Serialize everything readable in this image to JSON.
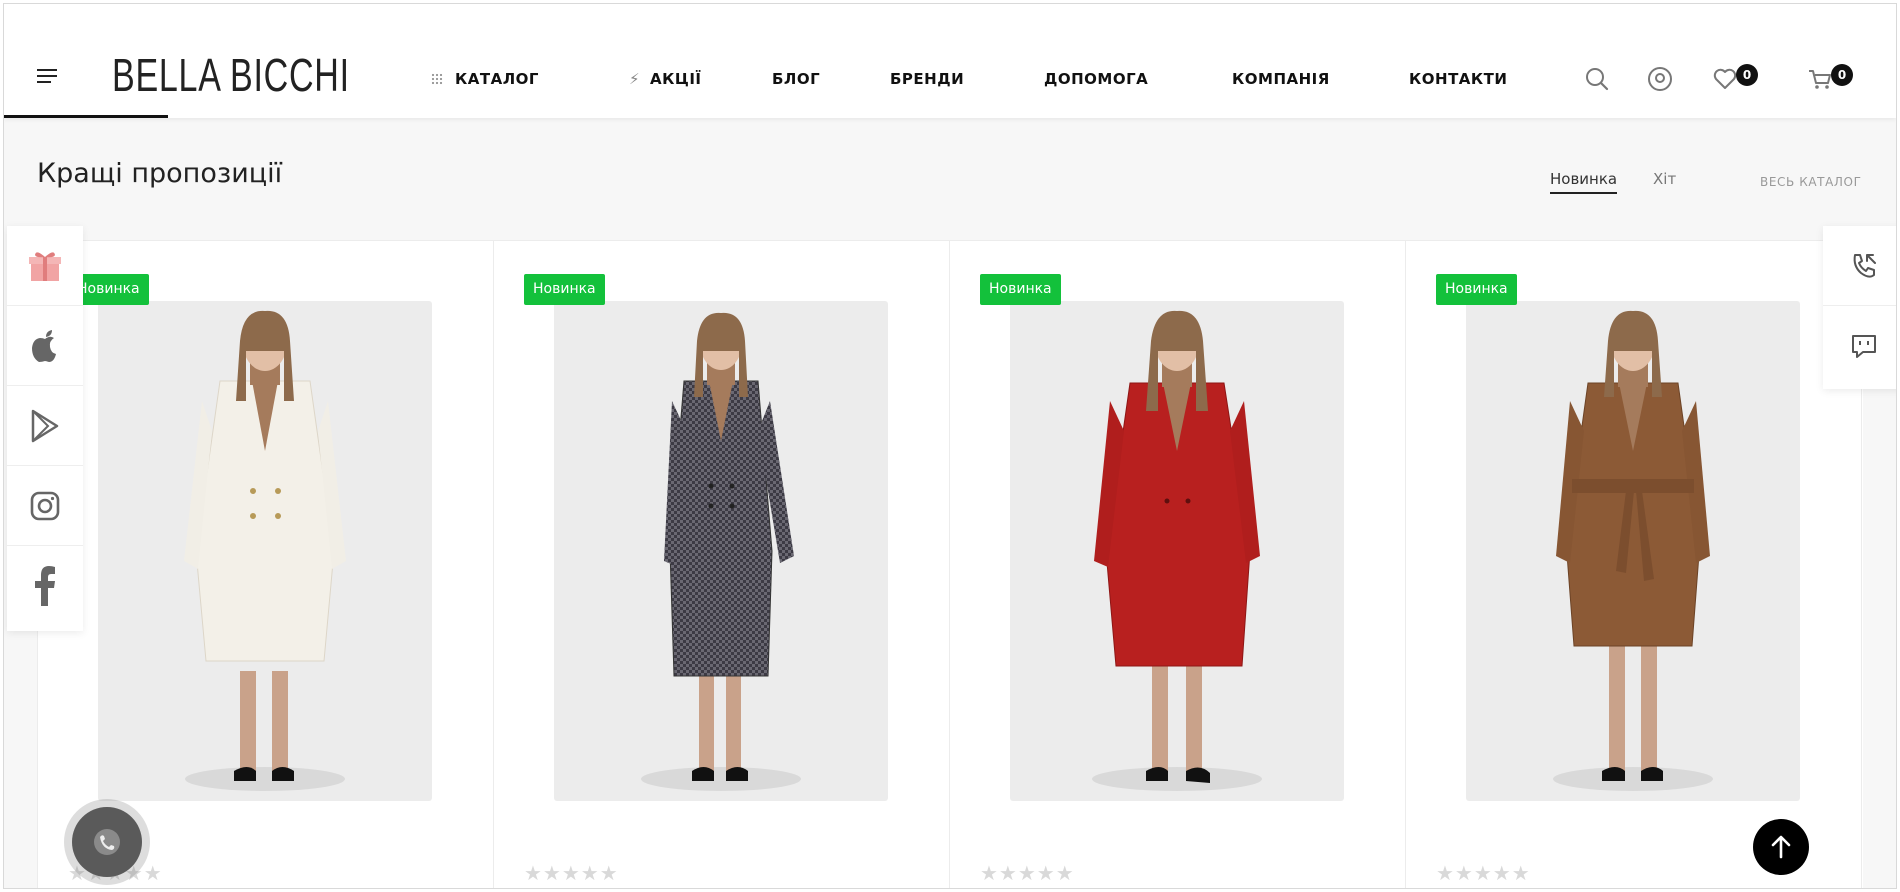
{
  "header": {
    "logo": "BELLA BICCHI",
    "nav": [
      {
        "label": "КАТАЛОГ",
        "icon": "grid-dots-icon"
      },
      {
        "label": "АКЦІЇ",
        "icon": "lightning-icon"
      },
      {
        "label": "БЛОГ"
      },
      {
        "label": "БРЕНДИ"
      },
      {
        "label": "ДОПОМОГА"
      },
      {
        "label": "КОМПАНІЯ"
      },
      {
        "label": "КОНТАКТИ"
      }
    ],
    "wishlist_count": "0",
    "cart_count": "0"
  },
  "section": {
    "title": "Кращі пропозиції",
    "tabs": [
      {
        "label": "Новинка",
        "active": true
      },
      {
        "label": "Хіт",
        "active": false
      }
    ],
    "catalog_link": "ВЕСЬ КАТАЛОГ"
  },
  "products": [
    {
      "badge": "Новинка",
      "coat_color": "#f3f0e8",
      "rating": 0,
      "stars": "★★★★★"
    },
    {
      "badge": "Новинка",
      "coat_color": "#54525c",
      "rating": 0,
      "stars": "★★★★★"
    },
    {
      "badge": "Новинка",
      "coat_color": "#b8201f",
      "rating": 0,
      "stars": "★★★★★"
    },
    {
      "badge": "Новинка",
      "coat_color": "#8c5a36",
      "rating": 0,
      "stars": "★★★★★"
    }
  ],
  "social": [
    "gift-icon",
    "apple-icon",
    "google-play-icon",
    "instagram-icon",
    "facebook-icon"
  ],
  "right_panel": [
    "callback-phone-icon",
    "chat-message-icon"
  ],
  "colors": {
    "badge_green": "#13c13b",
    "accent_dark": "#111111",
    "gift_pink": "#f1a4a4"
  }
}
